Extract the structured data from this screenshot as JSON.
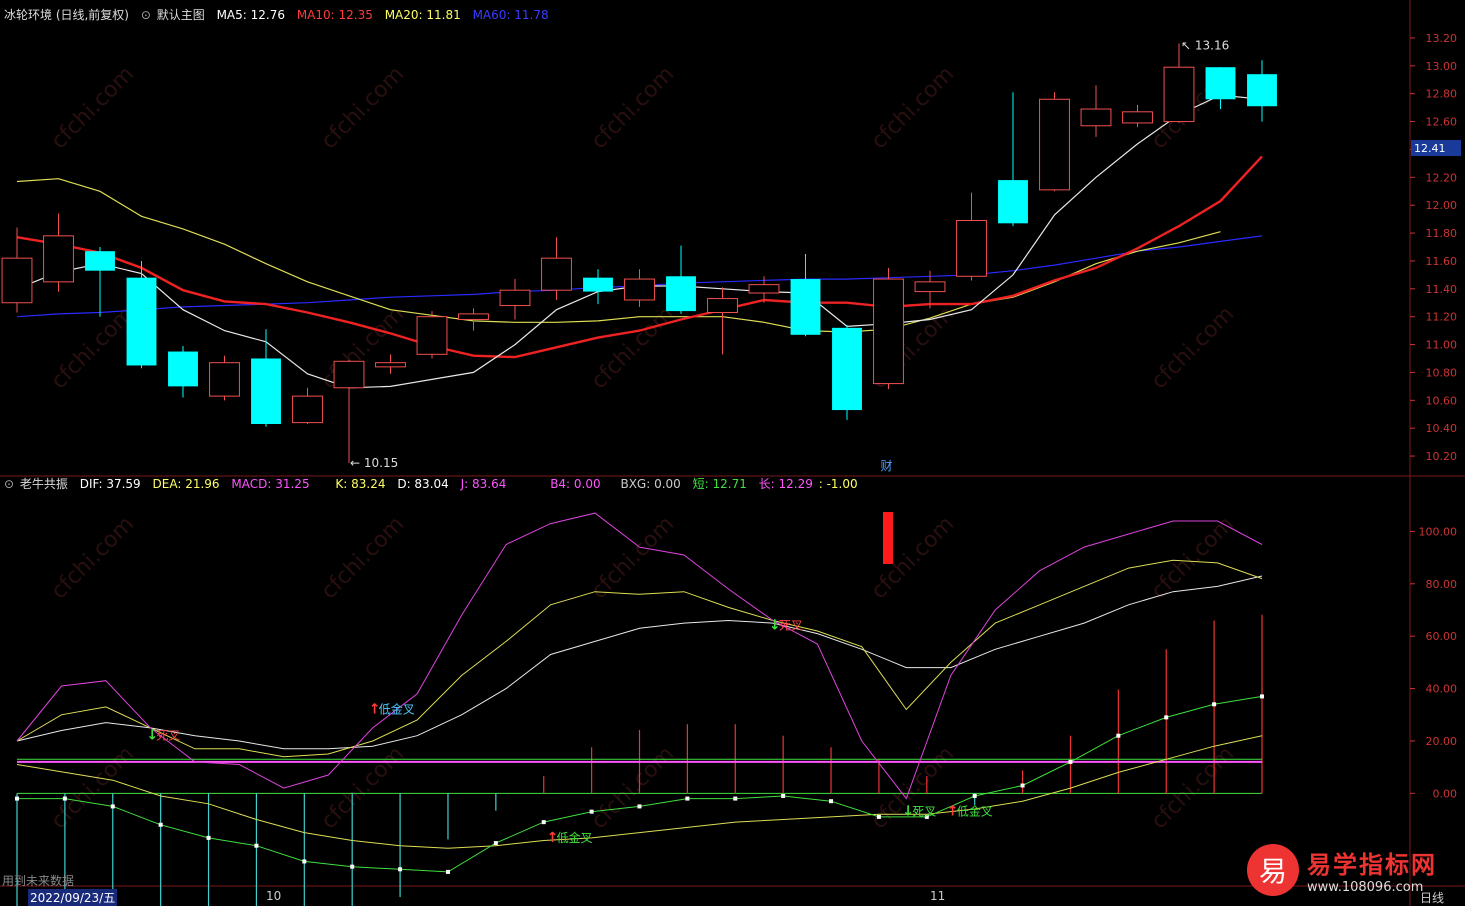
{
  "main_header": {
    "env": "冰轮环境 (日线,前复权)",
    "icon": "circle-toggle-icon",
    "template": "默认主图",
    "ma5": "MA5: 12.76",
    "ma10": "MA10: 12.35",
    "ma20": "MA20: 11.81",
    "ma60": "MA60: 11.78",
    "colors": {
      "ma5": "#ffffff",
      "ma10": "#ff3b3b",
      "ma20": "#ffff66",
      "ma60": "#3b3bff"
    }
  },
  "sub_header": {
    "name": "老牛共振",
    "dif": "DIF: 37.59",
    "dea": "DEA: 21.96",
    "macd": "MACD: 31.25",
    "k": "K: 83.24",
    "d": "D: 83.04",
    "j": "J: 83.64",
    "b4": "B4: 0.00",
    "bxg": "BXG: 0.00",
    "short": "短: 12.71",
    "long": "长: 12.29",
    "extra": ": -1.00"
  },
  "footer": {
    "note": "用到未来数据",
    "date": "2022/09/23/五",
    "month_oct": "10",
    "month_nov": "11",
    "period": "日线"
  },
  "brand": {
    "logo": "易",
    "name": "易学指标网",
    "url": "www.108096.com"
  },
  "watermark": "cfchi.com",
  "chart_data": {
    "type": "candlestick",
    "main": {
      "ylim": [
        10.1,
        13.3
      ],
      "yticks": [
        "13.20",
        "13.00",
        "12.80",
        "12.60",
        "12.40",
        "12.20",
        "12.00",
        "11.80",
        "11.60",
        "11.40",
        "11.20",
        "11.00",
        "10.80",
        "10.60",
        "10.40",
        "10.20"
      ],
      "current_price": "12.41",
      "high_label": "13.16",
      "low_label": "10.15",
      "event_label": "财",
      "candles": [
        {
          "o": 11.3,
          "c": 11.62,
          "h": 11.84,
          "l": 11.23
        },
        {
          "o": 11.45,
          "c": 11.78,
          "h": 11.94,
          "l": 11.38
        },
        {
          "o": 11.67,
          "c": 11.53,
          "h": 11.7,
          "l": 11.2
        },
        {
          "o": 11.48,
          "c": 10.85,
          "h": 11.6,
          "l": 10.83
        },
        {
          "o": 10.95,
          "c": 10.7,
          "h": 10.99,
          "l": 10.62
        },
        {
          "o": 10.63,
          "c": 10.87,
          "h": 10.92,
          "l": 10.6
        },
        {
          "o": 10.9,
          "c": 10.43,
          "h": 11.11,
          "l": 10.41
        },
        {
          "o": 10.44,
          "c": 10.63,
          "h": 10.69,
          "l": 10.43
        },
        {
          "o": 10.69,
          "c": 10.88,
          "h": 10.89,
          "l": 10.15
        },
        {
          "o": 10.84,
          "c": 10.87,
          "h": 10.93,
          "l": 10.79
        },
        {
          "o": 10.93,
          "c": 11.2,
          "h": 11.24,
          "l": 10.9
        },
        {
          "o": 11.18,
          "c": 11.22,
          "h": 11.26,
          "l": 11.1
        },
        {
          "o": 11.28,
          "c": 11.39,
          "h": 11.47,
          "l": 11.18
        },
        {
          "o": 11.39,
          "c": 11.62,
          "h": 11.77,
          "l": 11.32
        },
        {
          "o": 11.48,
          "c": 11.38,
          "h": 11.54,
          "l": 11.29
        },
        {
          "o": 11.32,
          "c": 11.47,
          "h": 11.54,
          "l": 11.27
        },
        {
          "o": 11.49,
          "c": 11.24,
          "h": 11.71,
          "l": 11.22
        },
        {
          "o": 11.23,
          "c": 11.33,
          "h": 11.41,
          "l": 10.93
        },
        {
          "o": 11.37,
          "c": 11.43,
          "h": 11.49,
          "l": 11.3
        },
        {
          "o": 11.47,
          "c": 11.07,
          "h": 11.65,
          "l": 11.06
        },
        {
          "o": 11.12,
          "c": 10.53,
          "h": 11.14,
          "l": 10.46
        },
        {
          "o": 10.72,
          "c": 11.47,
          "h": 11.55,
          "l": 10.68
        },
        {
          "o": 11.38,
          "c": 11.45,
          "h": 11.53,
          "l": 11.26
        },
        {
          "o": 11.49,
          "c": 11.89,
          "h": 12.09,
          "l": 11.46
        },
        {
          "o": 12.18,
          "c": 11.87,
          "h": 12.81,
          "l": 11.85
        },
        {
          "o": 12.11,
          "c": 12.76,
          "h": 12.81,
          "l": 12.1
        },
        {
          "o": 12.57,
          "c": 12.69,
          "h": 12.86,
          "l": 12.49
        },
        {
          "o": 12.59,
          "c": 12.67,
          "h": 12.72,
          "l": 12.56
        },
        {
          "o": 12.6,
          "c": 12.99,
          "h": 13.16,
          "l": 12.59
        },
        {
          "o": 12.99,
          "c": 12.76,
          "h": 12.99,
          "l": 12.69
        },
        {
          "o": 12.94,
          "c": 12.71,
          "h": 13.04,
          "l": 12.6
        }
      ],
      "ma5": [
        11.4,
        11.52,
        11.58,
        11.51,
        11.25,
        11.1,
        11.02,
        10.79,
        10.69,
        10.7,
        10.75,
        10.8,
        11.0,
        11.25,
        11.38,
        11.42,
        11.42,
        11.4,
        11.38,
        11.37,
        11.13,
        11.15,
        11.18,
        11.25,
        11.5,
        11.93,
        12.2,
        12.44,
        12.65,
        12.79,
        12.76
      ],
      "ma10": [
        11.77,
        11.72,
        11.66,
        11.55,
        11.39,
        11.31,
        11.29,
        11.23,
        11.16,
        11.08,
        10.99,
        10.92,
        10.91,
        10.98,
        11.05,
        11.1,
        11.18,
        11.25,
        11.32,
        11.3,
        11.3,
        11.27,
        11.29,
        11.29,
        11.35,
        11.46,
        11.55,
        11.69,
        11.85,
        12.03,
        12.35
      ],
      "ma20": [
        12.17,
        12.19,
        12.1,
        11.92,
        11.83,
        11.72,
        11.58,
        11.45,
        11.35,
        11.25,
        11.21,
        11.17,
        11.16,
        11.16,
        11.17,
        11.2,
        11.2,
        11.2,
        11.16,
        11.1,
        11.09,
        11.11,
        11.19,
        11.29,
        11.34,
        11.45,
        11.58,
        11.67,
        11.73,
        11.81
      ],
      "ma60": [
        11.2,
        11.22,
        11.23,
        11.25,
        11.27,
        11.28,
        11.29,
        11.3,
        11.32,
        11.34,
        11.35,
        11.36,
        11.38,
        11.39,
        11.41,
        11.42,
        11.44,
        11.45,
        11.46,
        11.47,
        11.47,
        11.48,
        11.49,
        11.5,
        11.53,
        11.57,
        11.62,
        11.67,
        11.7,
        11.74,
        11.78
      ]
    },
    "sub": {
      "ylim": [
        -35,
        112
      ],
      "yticks": [
        "100.00",
        "80.00",
        "60.00",
        "40.00",
        "20.00",
        "0.00"
      ],
      "k": [
        20,
        30,
        33,
        25,
        17,
        17,
        14,
        15,
        20,
        28,
        45,
        58,
        72,
        77,
        76,
        77,
        71,
        66,
        62,
        56,
        32,
        50,
        65,
        72,
        79,
        86,
        89,
        88,
        82
      ],
      "d": [
        20,
        24,
        27,
        25,
        22,
        20,
        17,
        17,
        18,
        22,
        30,
        40,
        53,
        58,
        63,
        65,
        66,
        65,
        61,
        55,
        48,
        48,
        55,
        60,
        65,
        72,
        77,
        79,
        83
      ],
      "j": [
        20,
        41,
        43,
        25,
        12,
        11,
        2,
        7,
        25,
        38,
        68,
        95,
        103,
        107,
        94,
        91,
        78,
        66,
        57,
        20,
        -2,
        45,
        70,
        85,
        94,
        99,
        104,
        104,
        95
      ],
      "dif": [
        -2,
        -2,
        -5,
        -12,
        -17,
        -20,
        -26,
        -28,
        -29,
        -30,
        -19,
        -11,
        -7,
        -5,
        -2,
        -2,
        -1,
        -3,
        -9,
        -9,
        -1,
        3,
        12,
        22,
        29,
        34,
        37
      ],
      "dea": [
        11,
        8,
        5,
        -1,
        -4,
        -10,
        -15,
        -18,
        -20,
        -21,
        -20,
        -18,
        -17,
        -15,
        -13,
        -11,
        -10,
        -9,
        -8,
        -8,
        -6,
        -3,
        2,
        8,
        13,
        18,
        22
      ],
      "hist": [
        -28,
        -22,
        -26,
        -28,
        -30,
        -30,
        -28,
        -22,
        -18,
        -8,
        -3,
        3,
        8,
        11,
        12,
        12,
        10,
        8,
        6,
        3,
        -2,
        4,
        10,
        18,
        25,
        30,
        31
      ],
      "short_line": [
        12.2,
        12.2,
        12.2,
        12.2,
        12.2,
        12.2,
        12.2,
        12.2,
        12.2,
        12.2,
        12.2,
        12.2,
        12.2,
        12.2,
        12.2,
        12.2,
        12.2,
        12.2,
        12.2,
        12.2,
        12.2,
        12.2,
        12.3,
        12.4,
        12.5,
        12.6,
        12.71
      ],
      "signals": [
        {
          "text": "死叉",
          "x": 3,
          "y": 22,
          "color": "#ff4444",
          "arrow": "down",
          "arrow_color": "#3fe03f"
        },
        {
          "text": "低金叉",
          "x": 8,
          "y": 32,
          "color": "#4fc8ff",
          "arrow": "up",
          "arrow_color": "#ff3b3b"
        },
        {
          "text": "死叉",
          "x": 17,
          "y": 64,
          "color": "#ff4444",
          "arrow": "down",
          "arrow_color": "#3fe03f"
        },
        {
          "text": "死叉",
          "x": 20,
          "y": -7,
          "color": "#3fe03f",
          "arrow": "down",
          "arrow_color": "#3fe03f"
        },
        {
          "text": "低金叉",
          "x": 21,
          "y": -7,
          "color": "#3fe03f",
          "arrow": "up",
          "arrow_color": "#ff3b3b"
        },
        {
          "text": "低金叉",
          "x": 12,
          "y": -17,
          "color": "#3fe03f",
          "arrow": "up",
          "arrow_color": "#ff3b3b"
        }
      ]
    }
  }
}
